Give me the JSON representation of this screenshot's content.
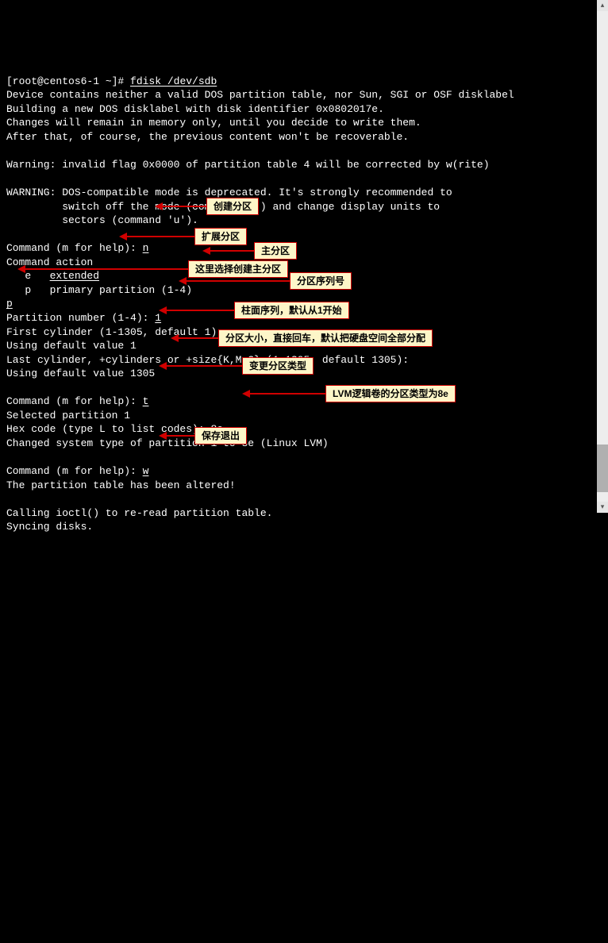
{
  "prompt": "[root@centos6-1 ~]# ",
  "command": "fdisk /dev/sdb",
  "lines": {
    "l1": "Device contains neither a valid DOS partition table, nor Sun, SGI or OSF disklabel",
    "l2": "Building a new DOS disklabel with disk identifier 0x0802017e.",
    "l3": "Changes will remain in memory only, until you decide to write them.",
    "l4": "After that, of course, the previous content won't be recoverable.",
    "l5": "",
    "l6": "Warning: invalid flag 0x0000 of partition table 4 will be corrected by w(rite)",
    "l7": "",
    "l8": "WARNING: DOS-compatible mode is deprecated. It's strongly recommended to",
    "l9": "         switch off the mode (command 'c') and change display units to",
    "l10": "         sectors (command 'u').",
    "l11": "",
    "l12a": "Command (m for help): ",
    "l12b": "n",
    "l13": "Command action",
    "l14a": "   e   ",
    "l14b": "extended",
    "l15": "   p   primary partition (1-4)",
    "l16": "p",
    "l17a": "Partition number (1-4): ",
    "l17b": "1",
    "l18": "First cylinder (1-1305, default 1):",
    "l19": "Using default value 1",
    "l20": "Last cylinder, +cylinders or +size{K,M,G} (1-1305, default 1305):",
    "l21": "Using default value 1305",
    "l22": "",
    "l23a": "Command (m for help): ",
    "l23b": "t",
    "l24": "Selected partition 1",
    "l25a": "Hex code (type L to list codes): ",
    "l25b": "8e",
    "l26": "Changed system type of partition 1 to 8e (Linux LVM)",
    "l27": "",
    "l28a": "Command (m for help): ",
    "l28b": "w",
    "l29": "The partition table has been altered!",
    "l30": "",
    "l31": "Calling ioctl() to re-read partition table.",
    "l32": "Syncing disks."
  },
  "annotations": {
    "a1": "创建分区",
    "a2": "扩展分区",
    "a3": "主分区",
    "a4": "这里选择创建主分区",
    "a5": "分区序列号",
    "a6": "柱面序列，默认从1开始",
    "a7": "分区大小，直接回车，默认把硬盘空间全部分配",
    "a8": "变更分区类型",
    "a9": "LVM逻辑卷的分区类型为8e",
    "a10": "保存退出"
  }
}
